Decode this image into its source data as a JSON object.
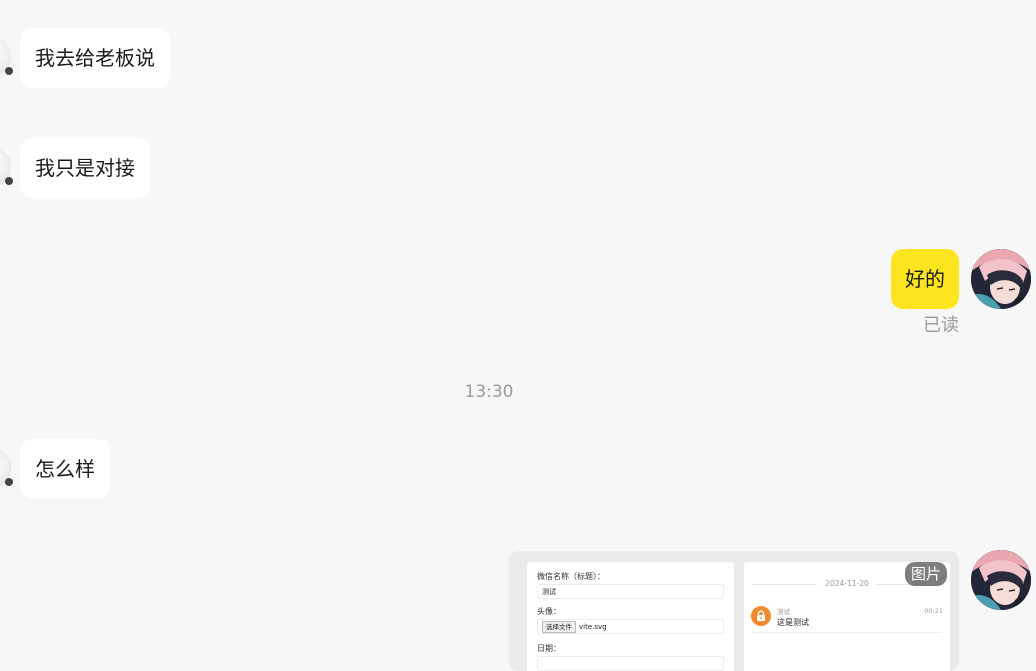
{
  "messages": {
    "m1": {
      "text": "我去给老板说"
    },
    "m2": {
      "text": "我只是对接"
    },
    "m3": {
      "text": "好的",
      "status": "已读"
    },
    "time_divider": "13:30",
    "m4": {
      "text": "怎么样"
    },
    "m5": {
      "badge": "图片",
      "screenshot": {
        "form": {
          "wechat_name_label": "微信名称（标题）：",
          "wechat_name_value": "测试",
          "avatar_label": "头像：",
          "file_button": "选择文件",
          "file_name": "vite.svg",
          "date_label": "日期："
        },
        "preview": {
          "date": "2024-11-20",
          "sender": "测试",
          "message": "这是测试",
          "time": "00:21"
        }
      }
    }
  },
  "colors": {
    "background": "#f7f7f7",
    "incoming_bubble": "#ffffff",
    "outgoing_bubble": "#fce51f",
    "muted_text": "#9b9b9b",
    "lock_icon": "#ef8b2c"
  }
}
